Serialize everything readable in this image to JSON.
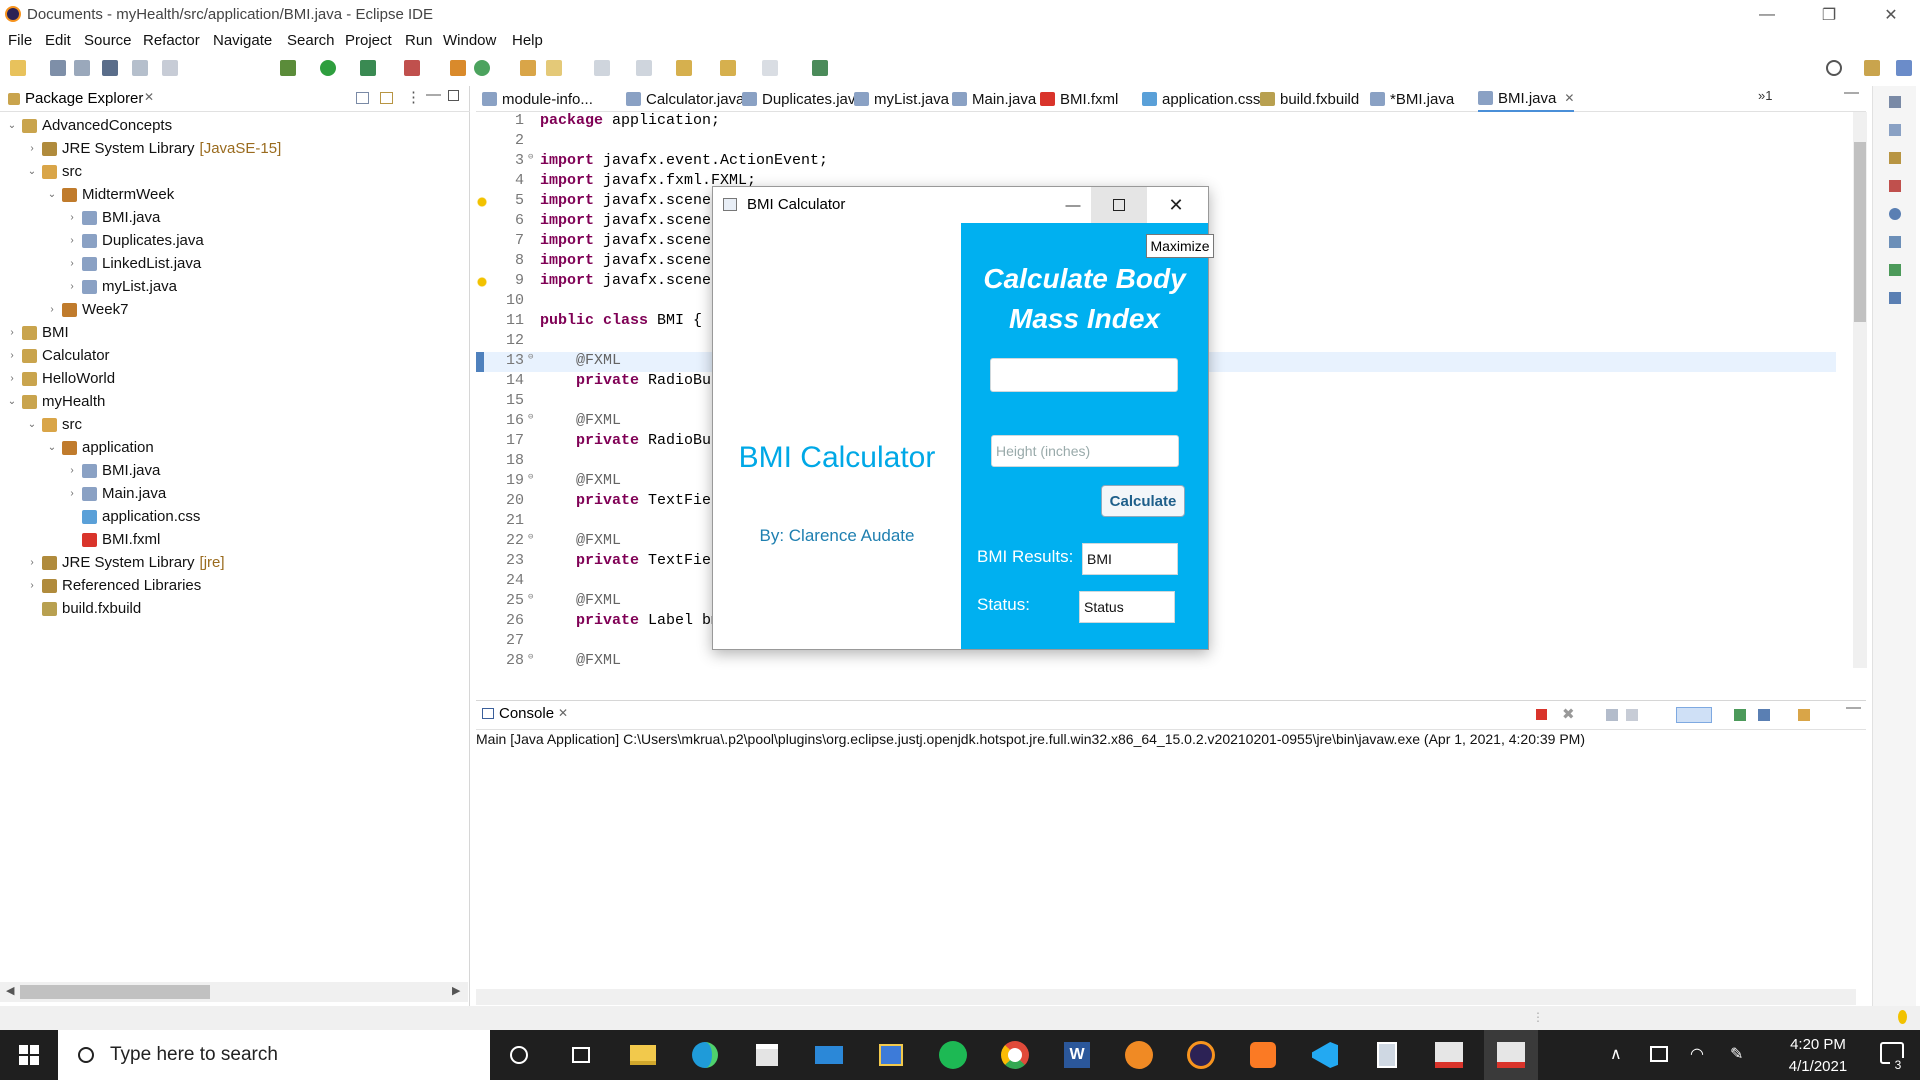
{
  "window": {
    "title": "Documents - myHealth/src/application/BMI.java - Eclipse IDE",
    "minimize": "—",
    "restore": "❐",
    "close": "✕"
  },
  "menu": [
    "File",
    "Edit",
    "Source",
    "Refactor",
    "Navigate",
    "Search",
    "Project",
    "Run",
    "Window",
    "Help"
  ],
  "package_explorer": {
    "title": "Package Explorer",
    "tree": [
      {
        "label": "AdvancedConcepts",
        "icon": "project-icon",
        "open": true,
        "depth": 0
      },
      {
        "label": "JRE System Library",
        "suffix": "[JavaSE-15]",
        "icon": "library-icon",
        "open": false,
        "depth": 1
      },
      {
        "label": "src",
        "icon": "source-folder-icon",
        "open": true,
        "depth": 1
      },
      {
        "label": "MidtermWeek",
        "icon": "package-icon",
        "open": true,
        "depth": 2
      },
      {
        "label": "BMI.java",
        "icon": "java-file-icon",
        "open": false,
        "depth": 3
      },
      {
        "label": "Duplicates.java",
        "icon": "java-file-icon",
        "open": false,
        "depth": 3
      },
      {
        "label": "LinkedList.java",
        "icon": "java-file-icon",
        "open": false,
        "depth": 3
      },
      {
        "label": "myList.java",
        "icon": "java-file-icon",
        "open": false,
        "depth": 3
      },
      {
        "label": "Week7",
        "icon": "package-icon",
        "open": false,
        "depth": 2
      },
      {
        "label": "BMI",
        "icon": "project-icon",
        "open": false,
        "depth": 0
      },
      {
        "label": "Calculator",
        "icon": "project-icon",
        "open": false,
        "depth": 0
      },
      {
        "label": "HelloWorld",
        "icon": "project-icon",
        "open": false,
        "depth": 0
      },
      {
        "label": "myHealth",
        "icon": "project-icon",
        "open": true,
        "depth": 0
      },
      {
        "label": "src",
        "icon": "source-folder-icon",
        "open": true,
        "depth": 1
      },
      {
        "label": "application",
        "icon": "package-icon",
        "open": true,
        "depth": 2
      },
      {
        "label": "BMI.java",
        "icon": "java-file-icon",
        "open": false,
        "depth": 3
      },
      {
        "label": "Main.java",
        "icon": "java-file-icon",
        "open": false,
        "depth": 3
      },
      {
        "label": "application.css",
        "icon": "css-file-icon",
        "open": null,
        "depth": 3
      },
      {
        "label": "BMI.fxml",
        "icon": "fxml-file-icon",
        "open": null,
        "depth": 3
      },
      {
        "label": "JRE System Library",
        "suffix": "[jre]",
        "icon": "library-icon",
        "open": false,
        "depth": 1
      },
      {
        "label": "Referenced Libraries",
        "icon": "library-icon",
        "open": false,
        "depth": 1
      },
      {
        "label": "build.fxbuild",
        "icon": "build-file-icon",
        "open": null,
        "depth": 1
      }
    ]
  },
  "editor_tabs": [
    {
      "label": "module-info...",
      "icon": "java-file-icon"
    },
    {
      "label": "Calculator.java",
      "icon": "java-file-icon"
    },
    {
      "label": "Duplicates.java",
      "icon": "java-file-icon"
    },
    {
      "label": "myList.java",
      "icon": "java-file-icon"
    },
    {
      "label": "Main.java",
      "icon": "java-file-icon"
    },
    {
      "label": "BMI.fxml",
      "icon": "fxml-file-icon"
    },
    {
      "label": "application.css",
      "icon": "css-file-icon"
    },
    {
      "label": "build.fxbuild",
      "icon": "build-file-icon"
    },
    {
      "label": "*BMI.java",
      "icon": "java-file-icon"
    },
    {
      "label": "BMI.java",
      "icon": "java-file-icon",
      "active": true
    }
  ],
  "editor_overflow": "»1",
  "code_lines": [
    {
      "n": "1",
      "code": "package application;"
    },
    {
      "n": "2",
      "code": ""
    },
    {
      "n": "3",
      "code": "import javafx.event.ActionEvent;",
      "fold": true
    },
    {
      "n": "4",
      "code": "import javafx.fxml.FXML;"
    },
    {
      "n": "5",
      "code": "import javafx.scene.co",
      "warn": true
    },
    {
      "n": "6",
      "code": "import javafx.scene.co"
    },
    {
      "n": "7",
      "code": "import javafx.scene.co"
    },
    {
      "n": "8",
      "code": "import javafx.scene.co"
    },
    {
      "n": "9",
      "code": "import javafx.scene.te",
      "warn": true
    },
    {
      "n": "10",
      "code": ""
    },
    {
      "n": "11",
      "code": "public class BMI {"
    },
    {
      "n": "12",
      "code": ""
    },
    {
      "n": "13",
      "code": "    @FXML",
      "fold": true,
      "current": true
    },
    {
      "n": "14",
      "code": "    private RadioButto"
    },
    {
      "n": "15",
      "code": ""
    },
    {
      "n": "16",
      "code": "    @FXML",
      "fold": true
    },
    {
      "n": "17",
      "code": "    private RadioButto"
    },
    {
      "n": "18",
      "code": ""
    },
    {
      "n": "19",
      "code": "    @FXML",
      "fold": true
    },
    {
      "n": "20",
      "code": "    private TextField"
    },
    {
      "n": "21",
      "code": ""
    },
    {
      "n": "22",
      "code": "    @FXML",
      "fold": true
    },
    {
      "n": "23",
      "code": "    private TextField"
    },
    {
      "n": "24",
      "code": ""
    },
    {
      "n": "25",
      "code": "    @FXML",
      "fold": true
    },
    {
      "n": "26",
      "code": "    private Label bmiR"
    },
    {
      "n": "27",
      "code": ""
    },
    {
      "n": "28",
      "code": "    @FXML",
      "fold": true
    }
  ],
  "console": {
    "title": "Console",
    "launch": "Main [Java Application] C:\\Users\\mkrua\\.p2\\pool\\plugins\\org.eclipse.justj.openjdk.hotspot.jre.full.win32.x86_64_15.0.2.v20210201-0955\\jre\\bin\\javaw.exe  (Apr 1, 2021, 4:20:39 PM)"
  },
  "bmi_dialog": {
    "title": "BMI Calculator",
    "heading": "BMI Calculator",
    "author": "By: Clarence Audate",
    "form_title_line1": "Calculate Body",
    "form_title_line2": "Mass Index",
    "weight_value": "",
    "height_placeholder": "Height (inches)",
    "calculate_label": "Calculate",
    "results_label": "BMI Results:",
    "results_value": "BMI",
    "status_label": "Status:",
    "status_value": "Status",
    "tooltip": "Maximize",
    "accent": "#00b0f0"
  },
  "taskbar": {
    "search_placeholder": "Type here to search",
    "time": "4:20 PM",
    "date": "4/1/2021",
    "notifications": "3"
  }
}
